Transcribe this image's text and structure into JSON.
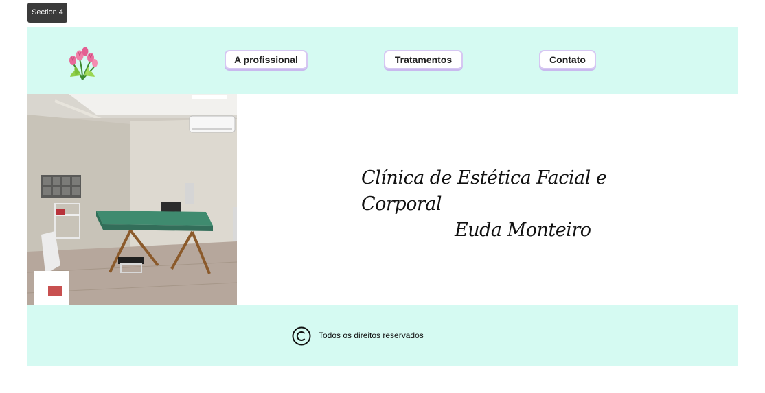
{
  "section_tag": "Section 4",
  "header": {
    "logo_icon": "tulip-bouquet-icon",
    "nav": [
      {
        "label": "A profissional"
      },
      {
        "label": "Tratamentos"
      },
      {
        "label": "Contato"
      }
    ]
  },
  "hero": {
    "title_line1": "Clínica de Estética Facial e Corporal",
    "title_line2": "Euda Monteiro"
  },
  "footer": {
    "copyright_icon": "copyright-icon",
    "text": "Todos os direitos reservados"
  },
  "colors": {
    "band": "#d5faf2",
    "button_border": "#d6c7f2"
  }
}
